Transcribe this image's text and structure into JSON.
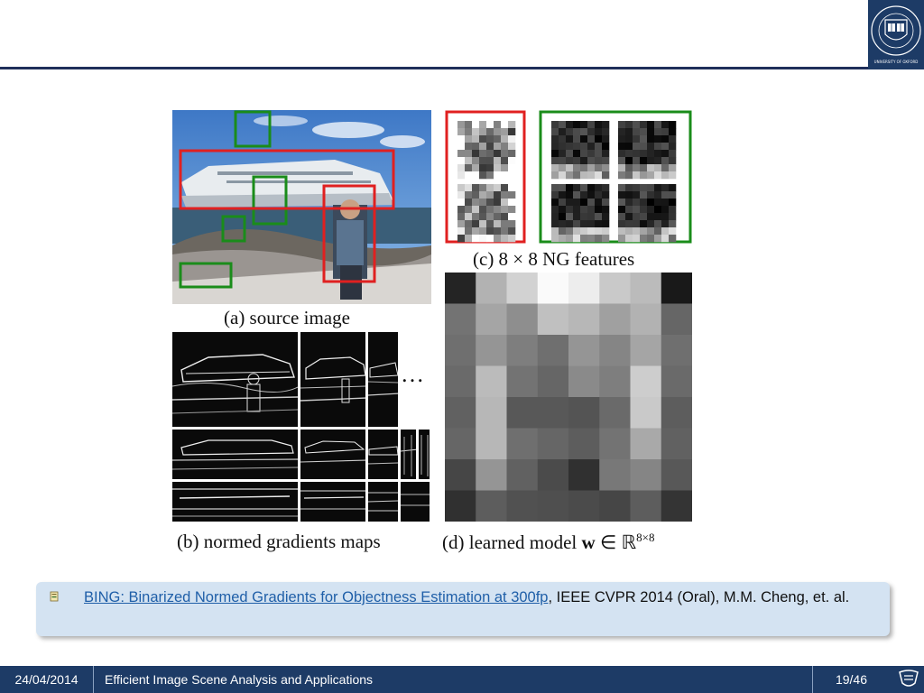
{
  "figure": {
    "caption_a": "(a) source image",
    "caption_b": "(b) normed gradients maps",
    "caption_c": "(c) 8 × 8 NG features",
    "caption_d_prefix": "(d) learned model ",
    "caption_d_bold": "w",
    "caption_d_mid": " ∈ ℝ",
    "caption_d_sup": "8×8",
    "ellipsis": "…",
    "model_grid": [
      [
        0.05,
        0.68,
        0.82,
        1.0,
        0.94,
        0.78,
        0.72,
        0.0
      ],
      [
        0.4,
        0.62,
        0.52,
        0.74,
        0.7,
        0.6,
        0.68,
        0.34
      ],
      [
        0.38,
        0.55,
        0.45,
        0.38,
        0.55,
        0.48,
        0.62,
        0.38
      ],
      [
        0.36,
        0.72,
        0.4,
        0.34,
        0.5,
        0.45,
        0.8,
        0.36
      ],
      [
        0.32,
        0.7,
        0.28,
        0.28,
        0.26,
        0.36,
        0.78,
        0.3
      ],
      [
        0.34,
        0.7,
        0.38,
        0.34,
        0.3,
        0.4,
        0.64,
        0.32
      ],
      [
        0.2,
        0.55,
        0.32,
        0.22,
        0.1,
        0.42,
        0.48,
        0.28
      ],
      [
        0.1,
        0.3,
        0.25,
        0.24,
        0.22,
        0.2,
        0.3,
        0.12
      ]
    ],
    "colors": {
      "object_box": "#e02020",
      "background_box": "#1a8c1a"
    }
  },
  "citation": {
    "icon": "bullet-icon",
    "link_text": "BING: Binarized Normed Gradients for Objectness Estimation at 300fp",
    "rest_text": ", IEEE CVPR 2014 (Oral), M.M. Cheng, et. al."
  },
  "footer": {
    "date": "24/04/2014",
    "title": "Efficient Image Scene Analysis and Applications",
    "page": "19/46",
    "logo": "oxford-logo-icon"
  },
  "header": {
    "crest": "oxford-crest-icon",
    "crest_text": "UNIVERSITY OF OXFORD"
  }
}
